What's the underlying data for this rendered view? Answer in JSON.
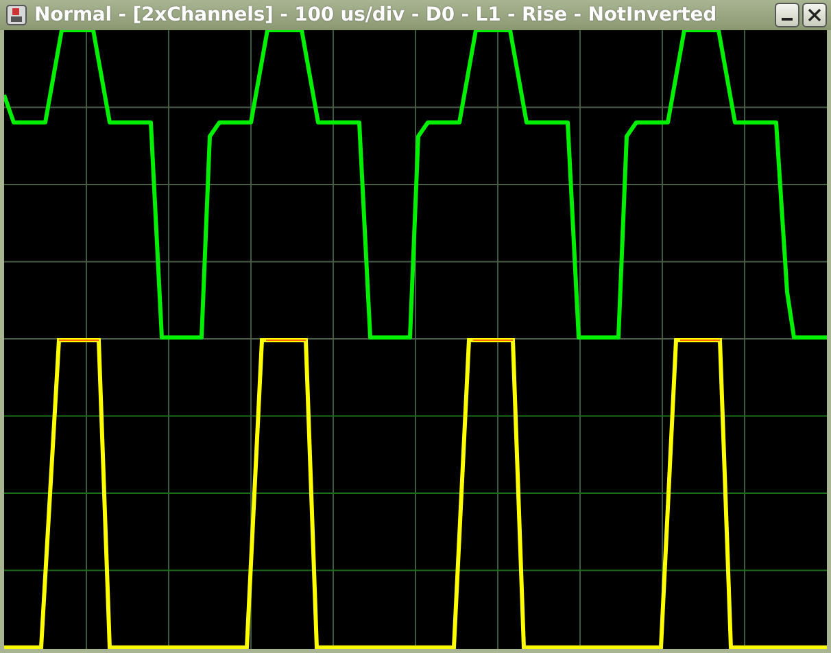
{
  "window": {
    "title": "Normal - [2xChannels] - 100 us/div - D0 - L1 - Rise - NotInverted"
  }
}
